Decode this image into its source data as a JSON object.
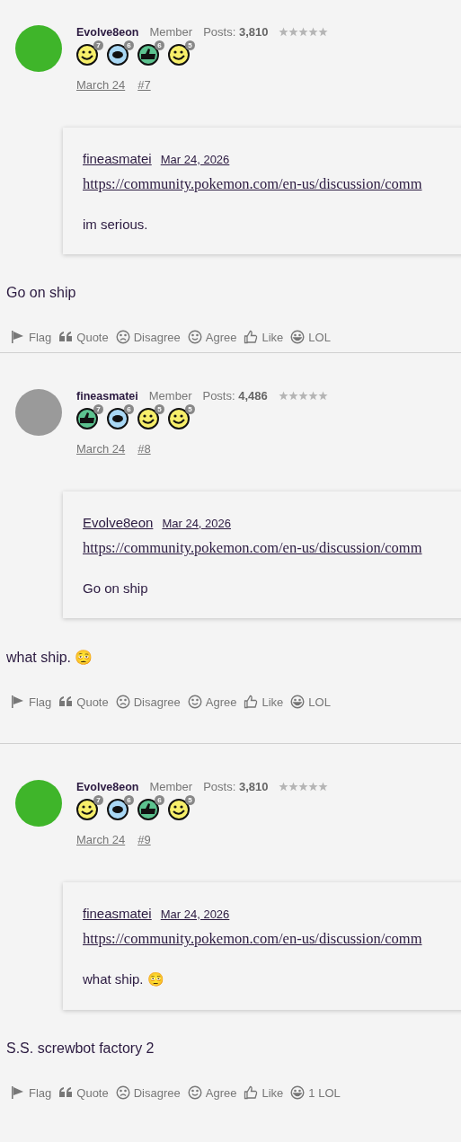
{
  "posts": [
    {
      "author": "Evolve8eon",
      "role": "Member",
      "posts_label": "Posts:",
      "posts_count": "3,810",
      "stars": 0,
      "color": "#3fb52a",
      "badges": [
        {
          "kind": "wink",
          "count": "7"
        },
        {
          "kind": "speech",
          "count": "6"
        },
        {
          "kind": "thumb",
          "count": "6"
        },
        {
          "kind": "smile",
          "count": "5"
        }
      ],
      "date": "March 24",
      "number": "#7",
      "quote": {
        "author": "fineasmatei",
        "date": "Mar 24, 2026",
        "link": "https://community.pokemon.com/en-us/discussion/comm",
        "text": "im serious."
      },
      "body": "Go on ship",
      "actions": [
        {
          "kind": "flag",
          "label": "Flag"
        },
        {
          "kind": "quote",
          "label": "Quote"
        },
        {
          "kind": "disagree",
          "label": "Disagree"
        },
        {
          "kind": "agree",
          "label": "Agree"
        },
        {
          "kind": "like",
          "label": "Like"
        },
        {
          "kind": "lol",
          "label": "LOL"
        }
      ]
    },
    {
      "author": "fineasmatei",
      "role": "Member",
      "posts_label": "Posts:",
      "posts_count": "4,486",
      "stars": 0,
      "color": "#9a9a9a",
      "badges": [
        {
          "kind": "thumb",
          "count": "7"
        },
        {
          "kind": "speech",
          "count": "6"
        },
        {
          "kind": "wink",
          "count": "5"
        },
        {
          "kind": "smile",
          "count": "5"
        }
      ],
      "date": "March 24",
      "number": "#8",
      "quote": {
        "author": "Evolve8eon",
        "date": "Mar 24, 2026",
        "link": "https://community.pokemon.com/en-us/discussion/comm",
        "text": "Go on ship"
      },
      "body": "what ship. 🫩",
      "actions": [
        {
          "kind": "flag",
          "label": "Flag"
        },
        {
          "kind": "quote",
          "label": "Quote"
        },
        {
          "kind": "disagree",
          "label": "Disagree"
        },
        {
          "kind": "agree",
          "label": "Agree"
        },
        {
          "kind": "like",
          "label": "Like"
        },
        {
          "kind": "lol",
          "label": "LOL"
        }
      ]
    },
    {
      "author": "Evolve8eon",
      "role": "Member",
      "posts_label": "Posts:",
      "posts_count": "3,810",
      "stars": 0,
      "color": "#3fb52a",
      "badges": [
        {
          "kind": "wink",
          "count": "7"
        },
        {
          "kind": "speech",
          "count": "6"
        },
        {
          "kind": "thumb",
          "count": "6"
        },
        {
          "kind": "smile",
          "count": "5"
        }
      ],
      "date": "March 24",
      "number": "#9",
      "quote": {
        "author": "fineasmatei",
        "date": "Mar 24, 2026",
        "link": "https://community.pokemon.com/en-us/discussion/comm",
        "text": "what ship. 🫩"
      },
      "body": "S.S. screwbot factory 2",
      "actions": [
        {
          "kind": "flag",
          "label": "Flag"
        },
        {
          "kind": "quote",
          "label": "Quote"
        },
        {
          "kind": "disagree",
          "label": "Disagree"
        },
        {
          "kind": "agree",
          "label": "Agree"
        },
        {
          "kind": "like",
          "label": "Like"
        },
        {
          "kind": "lol",
          "label": "1 LOL"
        }
      ]
    }
  ]
}
